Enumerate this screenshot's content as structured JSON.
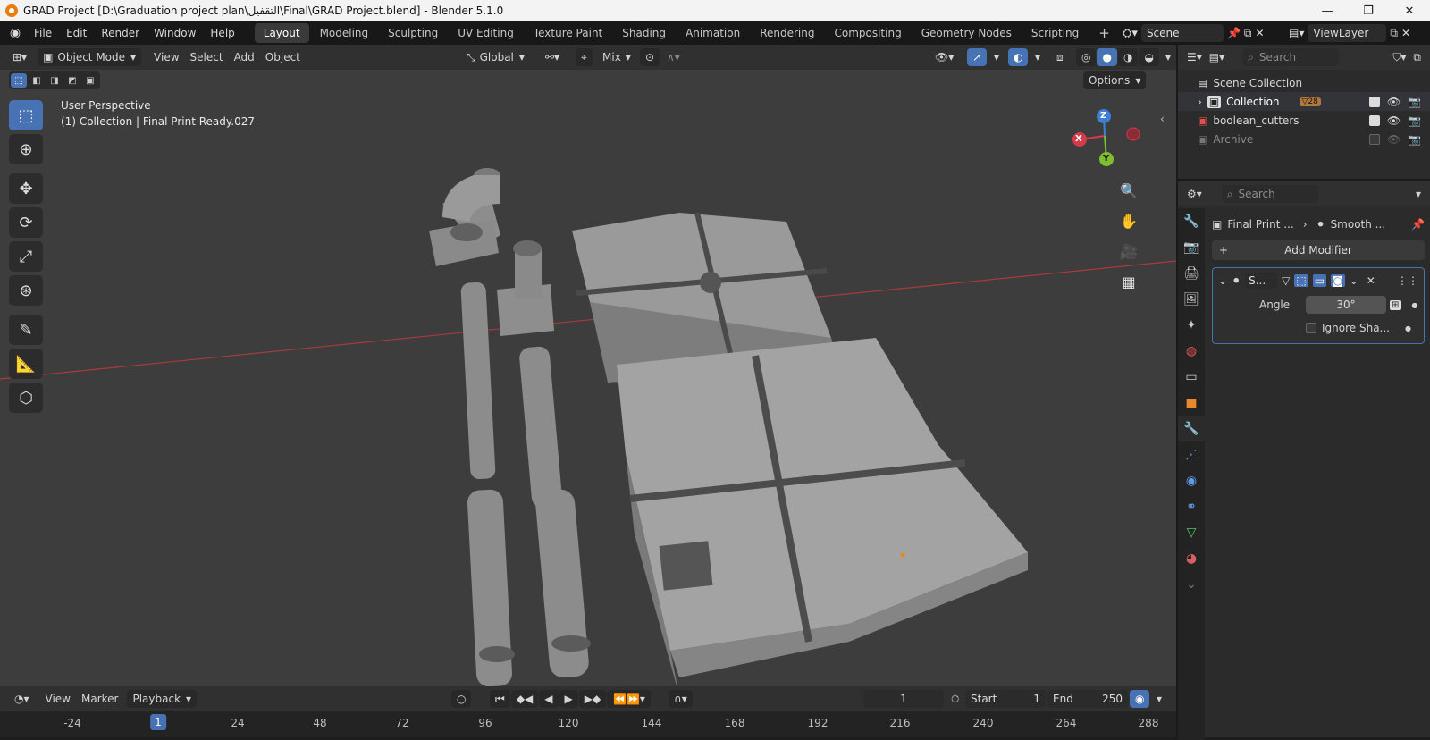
{
  "window": {
    "title": "GRAD Project [D:\\Graduation project plan\\التقفيل\\Final\\GRAD Project.blend] - Blender 5.1.0"
  },
  "menu": {
    "items": [
      "File",
      "Edit",
      "Render",
      "Window",
      "Help"
    ],
    "workspaces": [
      "Layout",
      "Modeling",
      "Sculpting",
      "UV Editing",
      "Texture Paint",
      "Shading",
      "Animation",
      "Rendering",
      "Compositing",
      "Geometry Nodes",
      "Scripting"
    ],
    "active_workspace": "Layout",
    "scene": "Scene",
    "view_layer": "ViewLayer"
  },
  "viewport_header": {
    "mode": "Object Mode",
    "menus": [
      "View",
      "Select",
      "Add",
      "Object"
    ],
    "orientation": "Global",
    "snap_target": "Mix",
    "options_label": "Options"
  },
  "viewport": {
    "perspective": "User Perspective",
    "collection_info": "(1) Collection | Final Print Ready.027",
    "gizmo": {
      "x": "X",
      "y": "Y",
      "z": "Z"
    }
  },
  "outliner": {
    "search_placeholder": "Search",
    "root": "Scene Collection",
    "items": [
      {
        "name": "Collection",
        "badge": "28"
      },
      {
        "name": "boolean_cutters"
      },
      {
        "name": "Archive"
      }
    ]
  },
  "properties": {
    "search_placeholder": "Search",
    "breadcrumb_object": "Final Print ...",
    "breadcrumb_modifier": "Smooth ...",
    "add_modifier": "Add Modifier",
    "modifier": {
      "name_short": "S...",
      "angle_label": "Angle",
      "angle_value": "30°",
      "ignore_label": "Ignore Sha..."
    }
  },
  "timeline": {
    "menus": [
      "View",
      "Marker",
      "Playback"
    ],
    "current_frame": "1",
    "start_label": "Start",
    "start_value": "1",
    "end_label": "End",
    "end_value": "250",
    "ruler": [
      "-24",
      "1",
      "24",
      "48",
      "72",
      "96",
      "120",
      "144",
      "168",
      "192",
      "216",
      "240",
      "264",
      "288"
    ]
  },
  "colors": {
    "accent": "#4772b3",
    "viewport_bg": "#3d3d3d",
    "x_axis": "#d53b4a",
    "y_axis": "#7fbf2e",
    "z_axis": "#3d80d8"
  }
}
